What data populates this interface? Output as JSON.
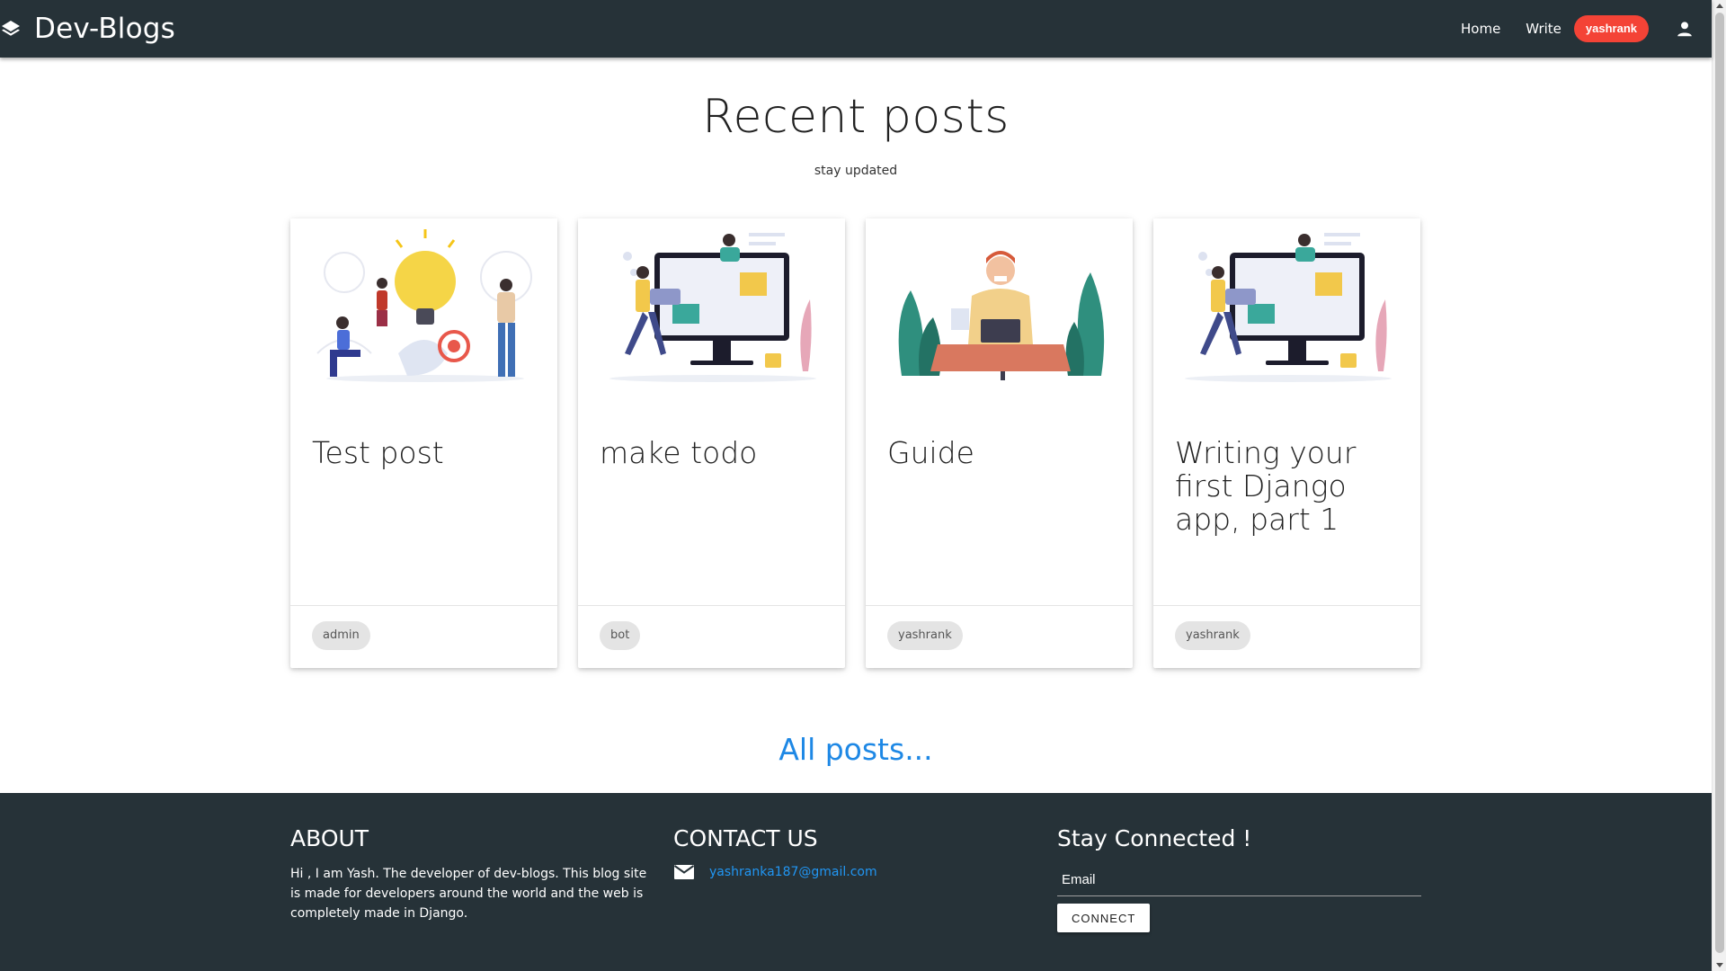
{
  "navbar": {
    "brand": "Dev-Blogs",
    "links": [
      {
        "label": "Home"
      },
      {
        "label": "Write"
      }
    ],
    "user": "yashrank",
    "colors": {
      "bar": "#263238",
      "badge": "#f44336"
    }
  },
  "hero": {
    "title": "Recent posts",
    "subtitle": "stay updated"
  },
  "posts": [
    {
      "title": "Test post",
      "author": "admin",
      "image_icon": "lightbulb-illustration"
    },
    {
      "title": "make todo",
      "author": "bot",
      "image_icon": "monitor-illustration"
    },
    {
      "title": "Guide",
      "author": "yashrank",
      "image_icon": "laptop-illustration"
    },
    {
      "title": "Writing your first Django app, part 1",
      "author": "yashrank",
      "image_icon": "monitor-illustration"
    }
  ],
  "all_posts_link": "All posts...",
  "footer": {
    "about": {
      "heading": "ABOUT",
      "text": "Hi , I am Yash. The developer of dev-blogs. This blog site is made for developers around the world and the web is completely made in Django."
    },
    "contact": {
      "heading": "CONTACT US",
      "email": "yashranka187@gmail.com"
    },
    "stay_connected": {
      "heading": "Stay Connected !",
      "email_placeholder": "Email",
      "button": "CONNECT"
    }
  }
}
